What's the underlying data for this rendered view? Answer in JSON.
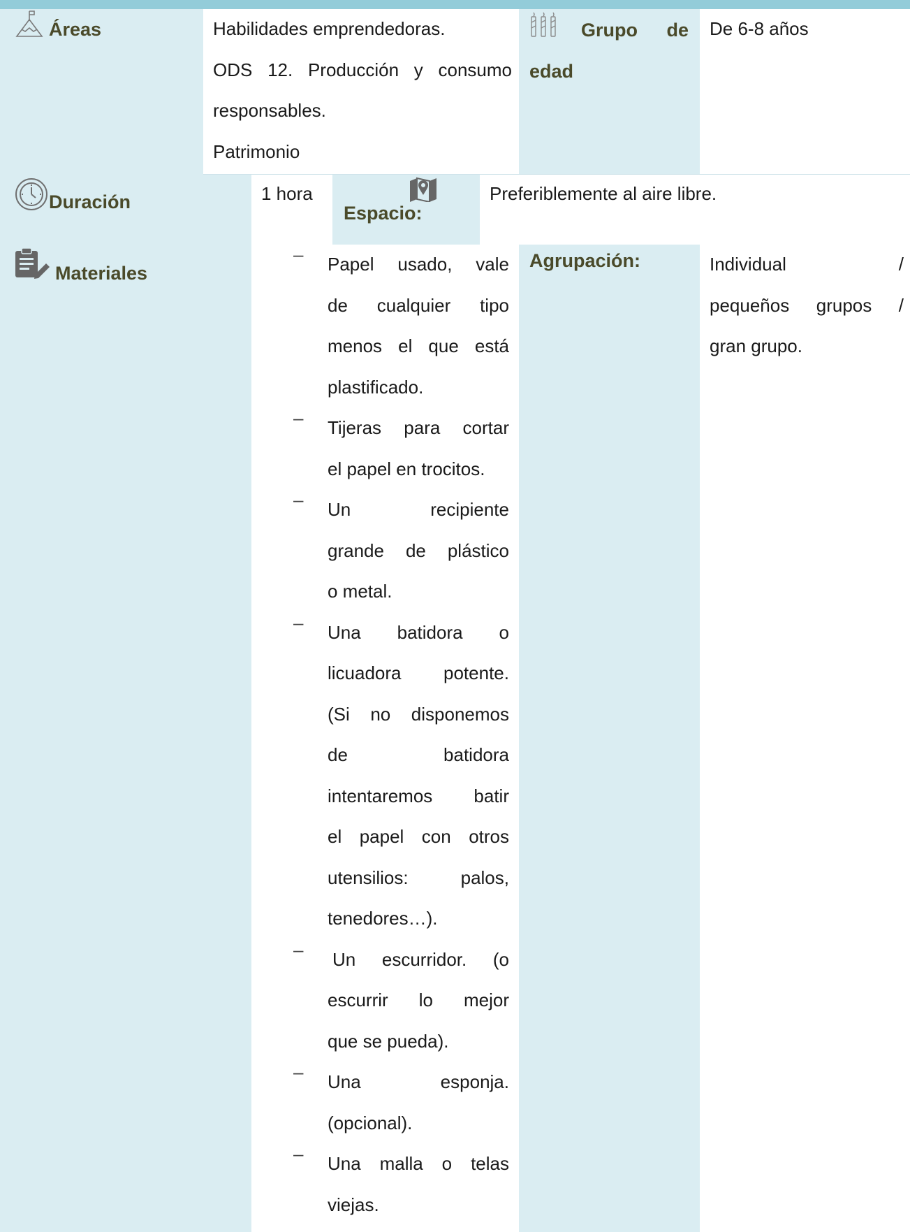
{
  "row1": {
    "areas_label": "Áreas",
    "areas_lines": [
      "Habilidades emprendedoras.",
      "ODS 12. Producción y consumo",
      "responsables.",
      "Patrimonio"
    ],
    "age_label_word1": "Grupo",
    "age_label_word2": "de",
    "age_label_word3": "edad",
    "age_value": "De 6-8 años"
  },
  "row2": {
    "duration_label": "Duración",
    "duration_value": "1 hora",
    "space_label": "Espacio:",
    "space_value": "Preferiblemente al aire libre."
  },
  "row3": {
    "materials_label": "Materiales",
    "materials": [
      {
        "dash": "–",
        "lines": [
          "Papel usado, vale",
          "de cualquier tipo",
          "menos el que está",
          "plastificado."
        ]
      },
      {
        "dash": "–",
        "lines": [
          "Tijeras para cortar",
          "el papel en trocitos."
        ]
      },
      {
        "dash": "–",
        "lines": [
          "Un recipiente",
          "grande de plástico",
          "o metal."
        ]
      },
      {
        "dash": "–",
        "lines": [
          "Una batidora o",
          "licuadora potente.",
          "(Si no disponemos",
          "de batidora",
          "intentaremos batir",
          "el papel con otros",
          "utensilios: palos,",
          "tenedores…)."
        ]
      },
      {
        "dash": "–",
        "lines": [
          " Un escurridor. (o",
          "escurrir lo mejor",
          "que se pueda)."
        ]
      },
      {
        "dash": "–",
        "lines": [
          "Una esponja.",
          "(opcional)."
        ]
      },
      {
        "dash": "–",
        "lines": [
          "Una malla o telas",
          "viejas."
        ]
      }
    ],
    "grouping_label": "Agrupación:",
    "grouping_lines": [
      "Individual /",
      "pequeños grupos /",
      "gran grupo."
    ]
  },
  "icons": {
    "areas": "mountain-flag-icon",
    "age": "candles-icon",
    "duration": "clock-icon",
    "space": "map-pin-icon",
    "materials": "clipboard-pencil-icon"
  },
  "colors": {
    "header_bar": "#93ccd9",
    "label_cell": "#daedf2",
    "label_text": "#4a4a2a",
    "icon": "#6f6f6f"
  }
}
